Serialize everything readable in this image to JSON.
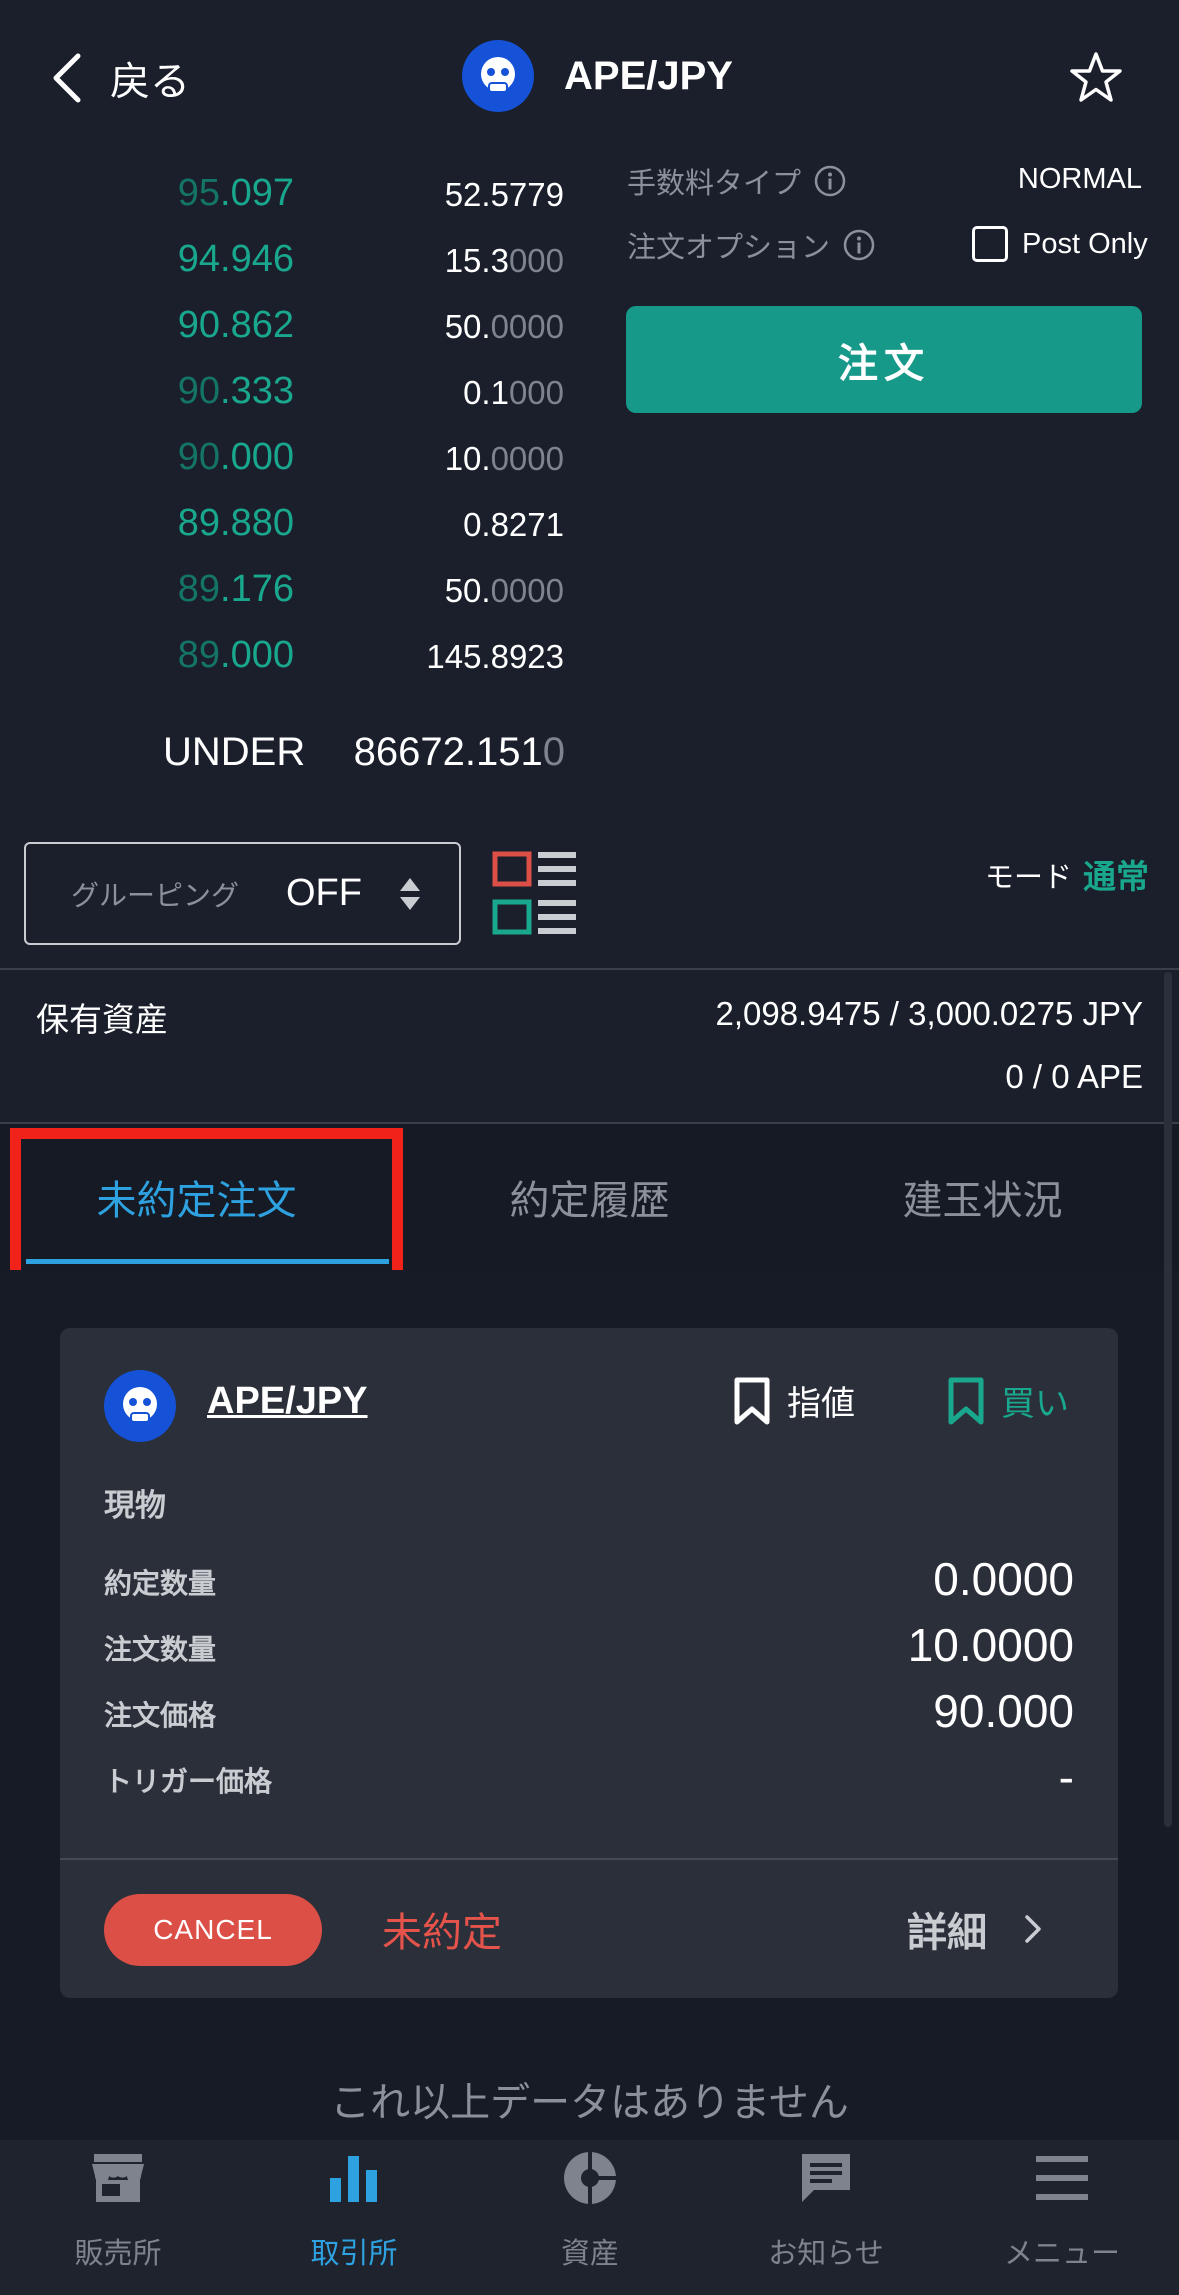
{
  "header": {
    "back_label": "戻る",
    "title": "APE/JPY"
  },
  "order_book": {
    "rows": [
      {
        "price_dim": "95",
        "price_main": ".097",
        "amount_main": "52.5779",
        "amount_dim": ""
      },
      {
        "price_dim": "",
        "price_main": "94.946",
        "amount_main": "15.3",
        "amount_dim": "000"
      },
      {
        "price_dim": "",
        "price_main": "90.862",
        "amount_main": "50.",
        "amount_dim": "0000"
      },
      {
        "price_dim": "90",
        "price_main": ".333",
        "amount_main": "0.1",
        "amount_dim": "000"
      },
      {
        "price_dim": "90",
        "price_main": ".000",
        "amount_main": "10.",
        "amount_dim": "0000"
      },
      {
        "price_dim": "",
        "price_main": "89.880",
        "amount_main": "0.8271",
        "amount_dim": ""
      },
      {
        "price_dim": "89",
        "price_main": ".176",
        "amount_main": "50.",
        "amount_dim": "0000"
      },
      {
        "price_dim": "89",
        "price_main": ".000",
        "amount_main": "145.8923",
        "amount_dim": ""
      }
    ],
    "under_label": "UNDER",
    "under_main": "86672.151",
    "under_dim": "0"
  },
  "order_panel": {
    "fee_type_label": "手数料タイプ",
    "fee_type_value": "NORMAL",
    "option_label": "注文オプション",
    "post_only_label": "Post Only",
    "order_button": "注文"
  },
  "grouping": {
    "label": "グルーピング",
    "value": "OFF"
  },
  "mode": {
    "label": "モード",
    "value": "通常"
  },
  "holdings": {
    "label": "保有資産",
    "jpy": "2,098.9475 / 3,000.0275  JPY",
    "ape": "0 / 0  APE"
  },
  "tabs": [
    {
      "label": "未約定注文",
      "active": true
    },
    {
      "label": "約定履歴",
      "active": false
    },
    {
      "label": "建玉状況",
      "active": false
    }
  ],
  "order_card": {
    "pair": "APE/JPY",
    "order_type": "指値",
    "side": "買い",
    "category": "現物",
    "fields": [
      {
        "label": "約定数量",
        "value": "0.0000"
      },
      {
        "label": "注文数量",
        "value": "10.0000"
      },
      {
        "label": "注文価格",
        "value": "90.000"
      },
      {
        "label": "トリガー価格",
        "value": "-"
      }
    ],
    "cancel_label": "CANCEL",
    "status": "未約定",
    "detail_label": "詳細"
  },
  "list_end_text": "これ以上データはありません",
  "bottom_nav": [
    {
      "label": "販売所",
      "icon": "store-icon",
      "active": false
    },
    {
      "label": "取引所",
      "icon": "bar-chart-icon",
      "active": true
    },
    {
      "label": "資産",
      "icon": "pie-chart-icon",
      "active": false
    },
    {
      "label": "お知らせ",
      "icon": "message-icon",
      "active": false
    },
    {
      "label": "メニュー",
      "icon": "menu-icon",
      "active": false
    }
  ],
  "colors": {
    "background": "#1a1f2b",
    "accent_green": "#19a88e",
    "accent_blue": "#2ea2e0",
    "sell_red": "#dc4f47",
    "highlight_red": "#f0221a"
  }
}
